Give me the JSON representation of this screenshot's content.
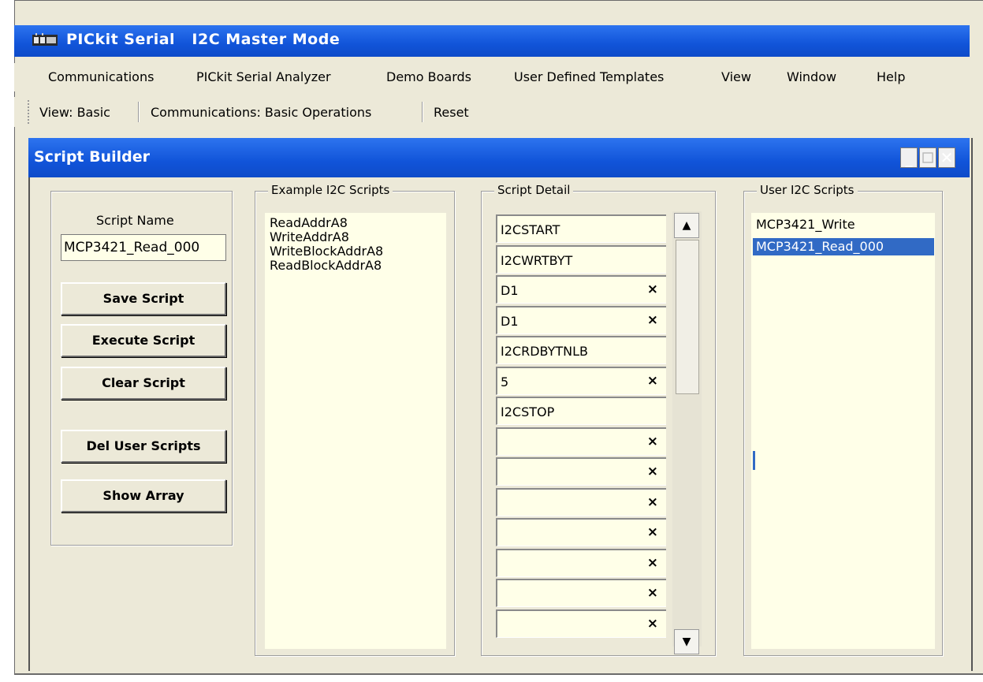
{
  "app": {
    "title": "PICkit Serial   I2C Master Mode"
  },
  "menu": [
    "Communications",
    "PICkit Serial Analyzer",
    "Demo Boards",
    "User Defined Templates",
    "View",
    "Window",
    "Help"
  ],
  "toolbar": {
    "view_label": "View: Basic",
    "comm_label": "Communications: Basic Operations",
    "reset_label": "Reset"
  },
  "script_builder": {
    "title": "Script Builder",
    "script_name_label": "Script Name",
    "script_name_value": "MCP3421_Read_000",
    "buttons": {
      "save": "Save Script",
      "execute": "Execute Script",
      "clear": "Clear Script",
      "del_user": "Del User Scripts",
      "show_array": "Show Array"
    },
    "example_group_label": "Example I2C Scripts",
    "example_scripts": [
      "ReadAddrA8",
      "WriteAddrA8",
      "WriteBlockAddrA8",
      "ReadBlockAddrA8"
    ],
    "detail_group_label": "Script Detail",
    "detail_rows": [
      {
        "text": "I2CSTART",
        "x": false
      },
      {
        "text": "I2CWRTBYT",
        "x": false
      },
      {
        "text": "D1",
        "x": true
      },
      {
        "text": "D1",
        "x": true
      },
      {
        "text": "I2CRDBYTNLB",
        "x": false
      },
      {
        "text": "5",
        "x": true
      },
      {
        "text": "I2CSTOP",
        "x": false
      },
      {
        "text": "",
        "x": true
      },
      {
        "text": "",
        "x": true
      },
      {
        "text": "",
        "x": true
      },
      {
        "text": "",
        "x": true
      },
      {
        "text": "",
        "x": true
      },
      {
        "text": "",
        "x": true
      },
      {
        "text": "",
        "x": true
      }
    ],
    "x_glyph": "×",
    "user_group_label": "User I2C Scripts",
    "user_scripts": [
      "MCP3421_Write",
      "MCP3421_Read_000"
    ],
    "selected_user_script": "MCP3421_Read_000"
  },
  "colors": {
    "titlebar": "#1154d9",
    "selection": "#316ac5",
    "list_bg": "#ffffe8",
    "chrome": "#ece9d8"
  },
  "icons": {
    "minimize": "minimize-icon",
    "maximize": "maximize-icon",
    "close": "close-icon",
    "scroll_up": "scroll-up-icon",
    "scroll_down": "scroll-down-icon"
  }
}
